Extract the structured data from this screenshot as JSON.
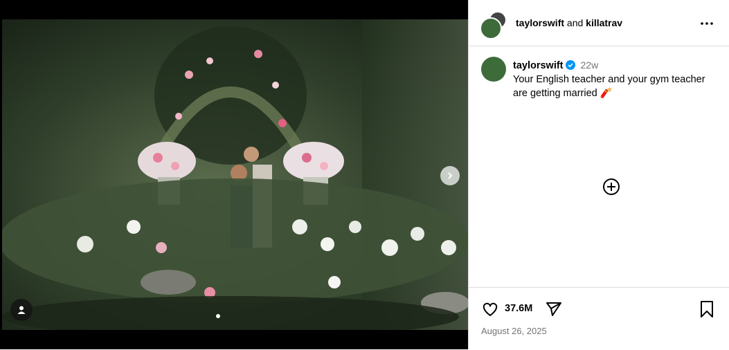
{
  "header": {
    "user1": "taylorswift",
    "connector": "and",
    "user2": "killatrav"
  },
  "caption": {
    "username": "taylorswift",
    "time_ago": "22w",
    "text": "Your English teacher and your gym teacher are getting married 🧨"
  },
  "icons": {
    "more": "more-options-icon",
    "add": "add-circle-icon",
    "like": "heart-icon",
    "share": "send-icon",
    "save": "bookmark-icon",
    "verified": "verified-badge-icon",
    "next": "chevron-right-icon",
    "tag": "user-tag-icon"
  },
  "stats": {
    "likes": "37.6M",
    "date": "August 26, 2025"
  },
  "colors": {
    "verified": "#0095f6",
    "muted": "#737373"
  }
}
